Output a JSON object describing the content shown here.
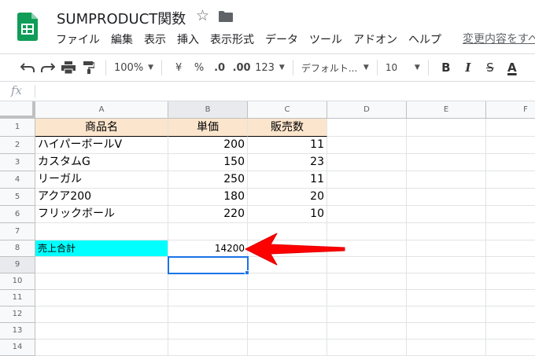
{
  "doc": {
    "title": "SUMPRODUCT関数",
    "last_edit": "変更内容をすべ"
  },
  "menu": [
    "ファイル",
    "編集",
    "表示",
    "挿入",
    "表示形式",
    "データ",
    "ツール",
    "アドオン",
    "ヘルプ"
  ],
  "toolbar": {
    "zoom": "100%",
    "currency": "¥",
    "percent": "%",
    "decimal_decrease": ".0",
    "decimal_increase": ".00",
    "more_formats": "123",
    "font": "デフォルト...",
    "font_size": "10",
    "bold": "B",
    "italic": "I",
    "strikethrough": "S",
    "text_color": "A"
  },
  "formula_bar": {
    "icon": "fx"
  },
  "columns": [
    "A",
    "B",
    "C",
    "D",
    "E",
    "F"
  ],
  "rows": [
    "1",
    "2",
    "3",
    "4",
    "5",
    "6",
    "7",
    "8",
    "9",
    "10",
    "11",
    "12",
    "13",
    "14"
  ],
  "table": {
    "headers": [
      "商品名",
      "単価",
      "販売数"
    ],
    "rows": [
      [
        "ハイパーボールV",
        "200",
        "11"
      ],
      [
        "カスタムG",
        "150",
        "23"
      ],
      [
        "リーガル",
        "250",
        "11"
      ],
      [
        "アクア200",
        "180",
        "20"
      ],
      [
        "フリックボール",
        "220",
        "10"
      ]
    ]
  },
  "total": {
    "label": "売上合計",
    "value": "14200"
  },
  "colors": {
    "header_fill": "#fce5cd",
    "total_label_fill": "#00ffff",
    "selection": "#1a73e8",
    "arrow": "#ff0000",
    "sheets_green": "#0f9d58"
  }
}
